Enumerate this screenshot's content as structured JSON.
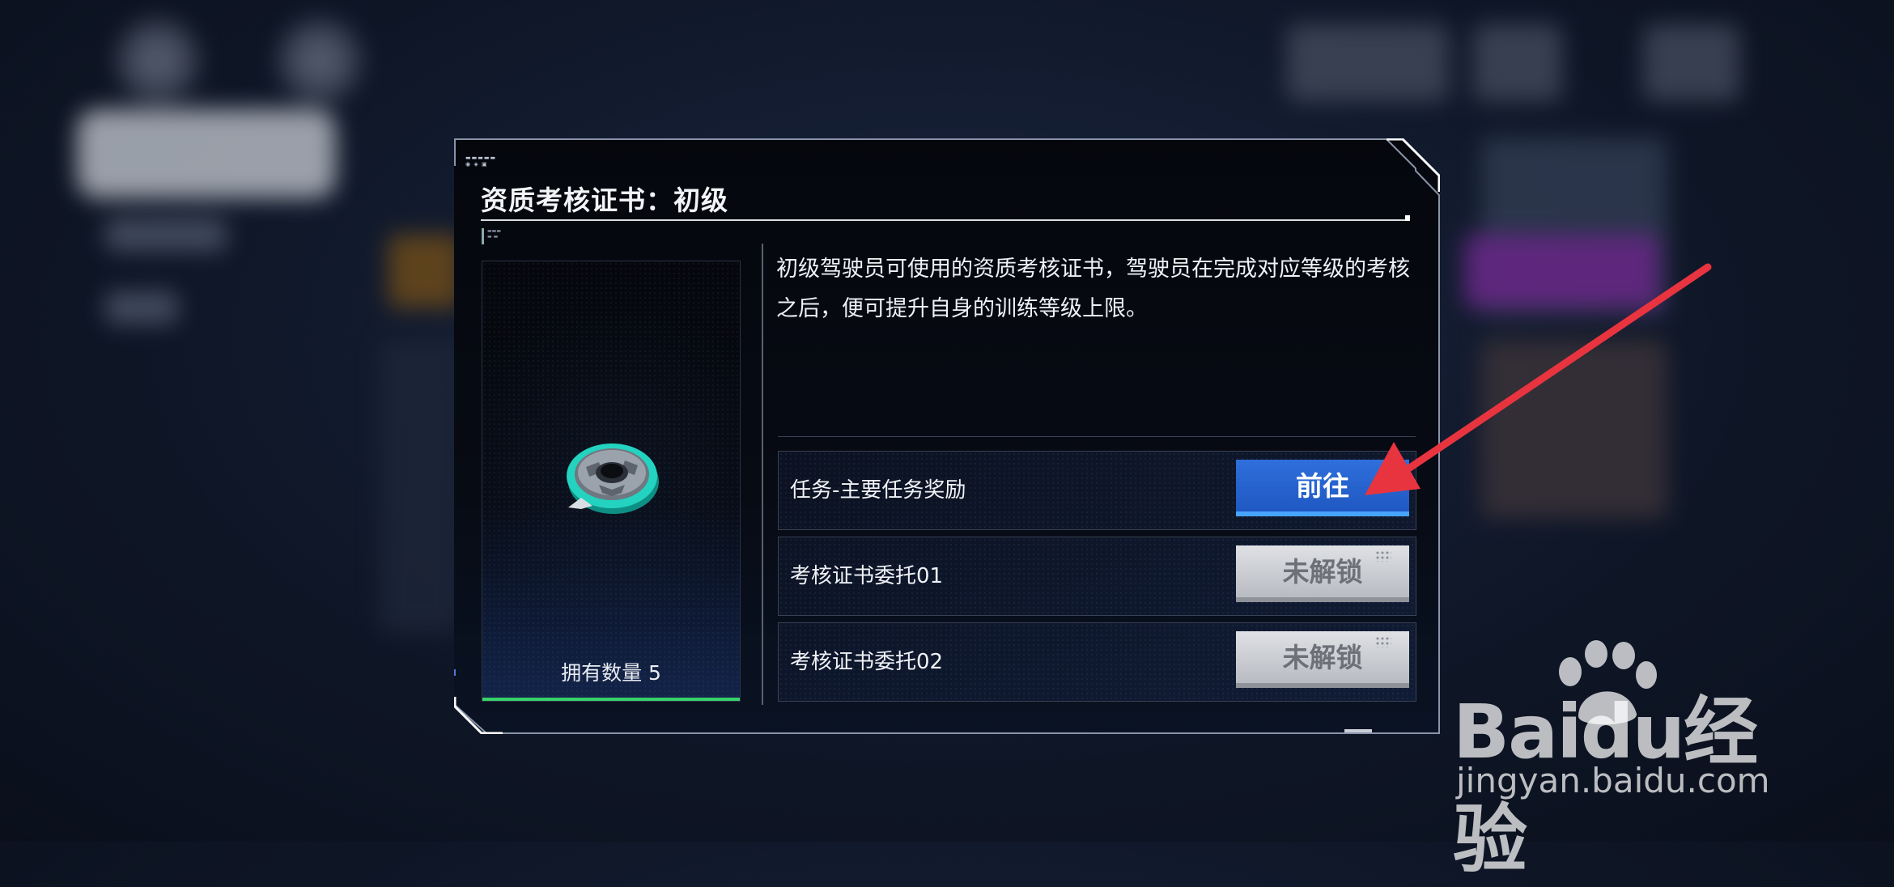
{
  "dialog": {
    "title": "资质考核证书：初级",
    "description": "初级驾驶员可使用的资质考核证书，驾驶员在完成对应等级的考核之后，便可提升自身的训练等级上限。",
    "item": {
      "icon": "certificate-disc-icon",
      "count_text": "拥有数量 5"
    },
    "sources": [
      {
        "label": "任务-主要任务奖励",
        "button": "前往",
        "state": "available"
      },
      {
        "label": "考核证书委托01",
        "button": "未解锁",
        "state": "locked"
      },
      {
        "label": "考核证书委托02",
        "button": "未解锁",
        "state": "locked"
      }
    ]
  },
  "watermark": {
    "brand_text": "Baidu",
    "brand_cn": "经验",
    "url": "jingyan.baidu.com"
  },
  "colors": {
    "go_button": "#2f6fdc",
    "locked_button": "#c9ccd2",
    "count_bar": "#37d36a",
    "arrow": "#e8343f"
  }
}
